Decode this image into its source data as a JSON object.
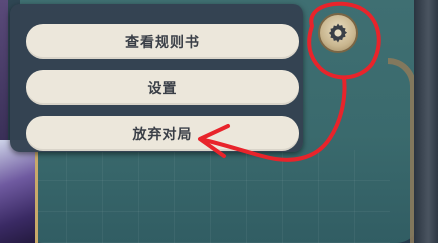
{
  "menu": {
    "items": [
      {
        "label": "查看规则书"
      },
      {
        "label": "设置"
      },
      {
        "label": "放弃对局"
      }
    ]
  },
  "gear": {
    "icon": "gear-icon"
  },
  "annotation": {
    "color": "#e8242b"
  }
}
